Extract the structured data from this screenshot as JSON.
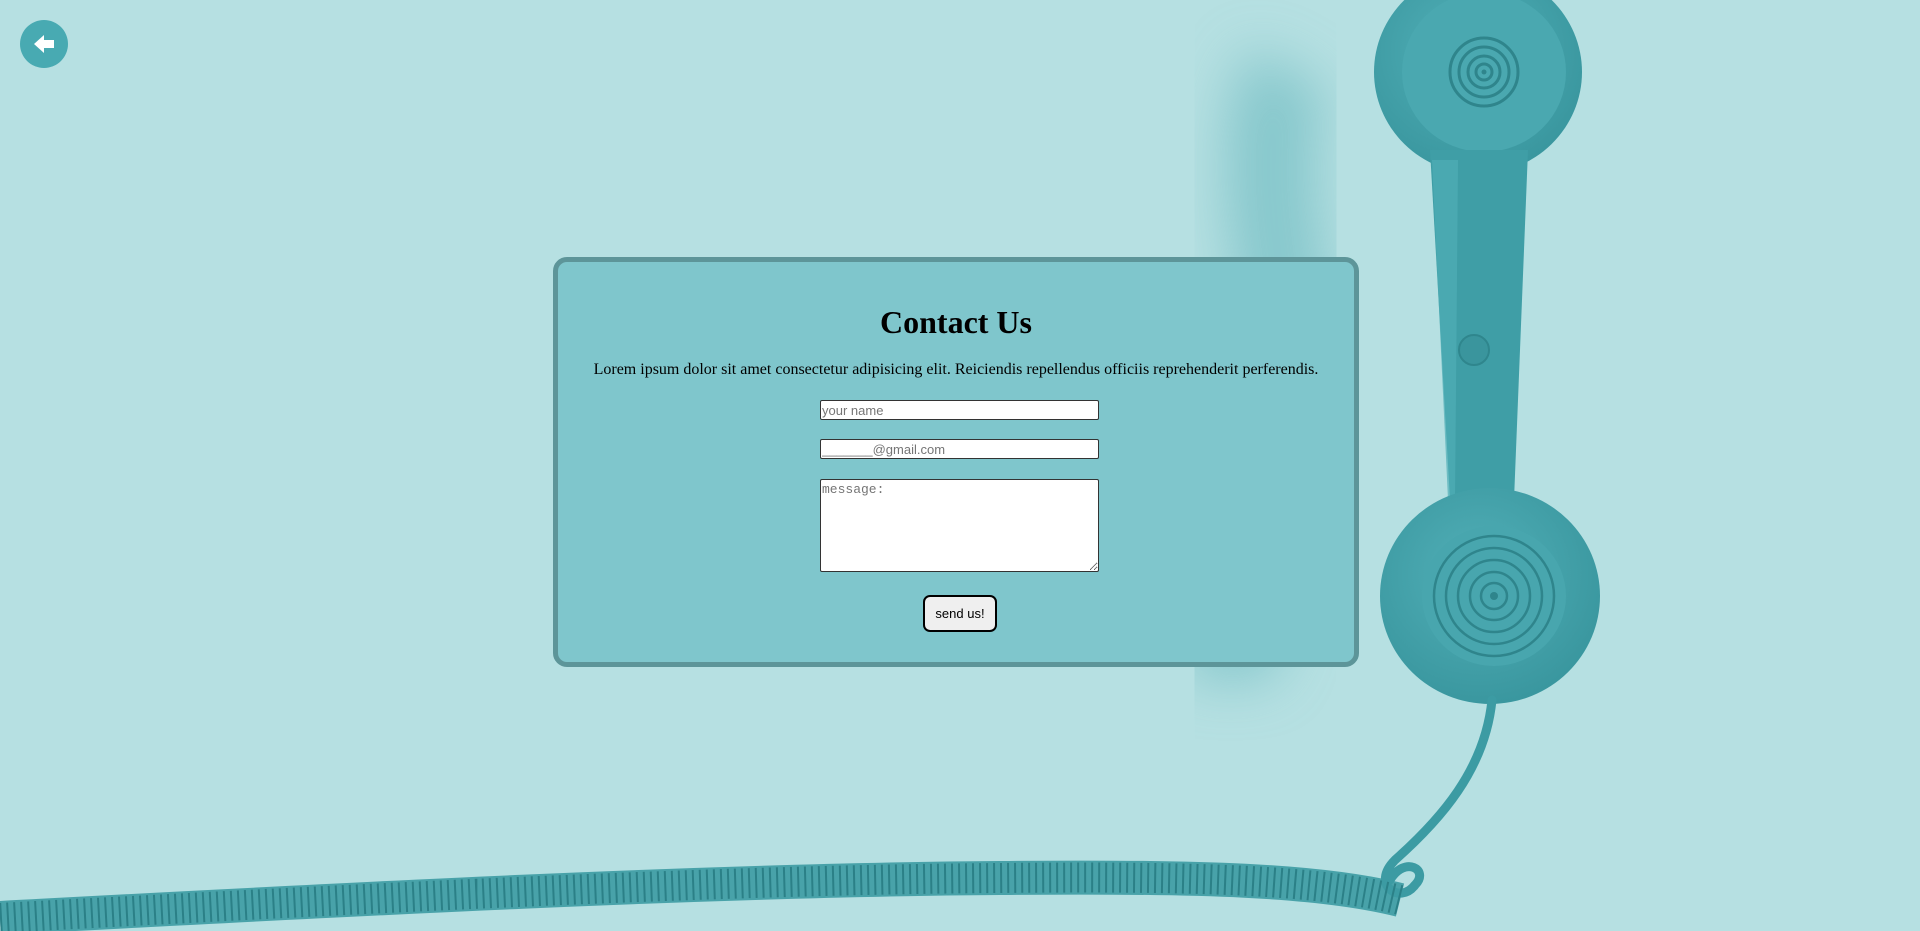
{
  "nav": {
    "back_icon": "arrow-left-icon"
  },
  "contact": {
    "title": "Contact Us",
    "description": "Lorem ipsum dolor sit amet consectetur adipisicing elit. Reiciendis repellendus officiis reprehenderit perferendis.",
    "name_placeholder": "your name",
    "email_placeholder": "_______@gmail.com",
    "message_placeholder": "message:",
    "submit_label": "send us!"
  },
  "theme": {
    "background": "#b6e0e2",
    "card": "#7fc6cc",
    "card_border": "#5d9599",
    "accent": "#48aab2"
  }
}
